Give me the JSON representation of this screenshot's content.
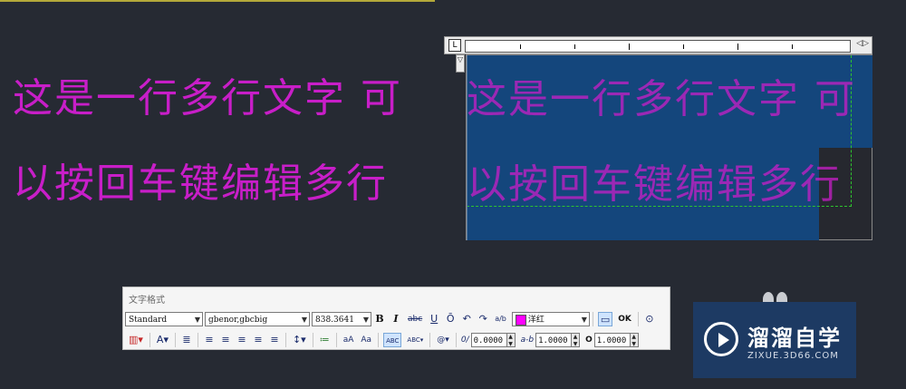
{
  "canvas": {
    "line1": "这是一行多行文字  可",
    "line2": "以按回车键编辑多行"
  },
  "editor": {
    "ruler_tab_label": "L",
    "ruler_end_label": "◁▷",
    "indent_label": "▽",
    "line1": "这是一行多行文字  可",
    "line2": "以按回车键编辑多行"
  },
  "toolbar": {
    "title": "文字格式",
    "style": "Standard",
    "font": "gbenor,gbcbig",
    "height": "838.3641",
    "bold": "B",
    "italic": "I",
    "strike": "abc",
    "underline": "U",
    "overline": "Ō",
    "undo": "↶",
    "redo": "↷",
    "stack": "a/b",
    "color_label": "洋红",
    "color_hex": "#ff00ff",
    "ruler_toggle": "▭",
    "ok": "OK",
    "options": "⊙",
    "columns": "▥▾",
    "mtext_just": "A▾",
    "para": "≣",
    "align_left": "≡",
    "align_center": "≡",
    "align_right": "≡",
    "align_justify": "≡",
    "align_distribute": "≡",
    "line_spacing": "↕▾",
    "numbering": "≔",
    "upper": "aA",
    "lower": "Aa",
    "field": "ABC",
    "spell": "ABC▾",
    "symbol": "@▾",
    "oblique_icon": "0/",
    "oblique": "0.0000",
    "tracking_icon": "a-b",
    "tracking": "1.0000",
    "width_icon": "O",
    "width": "1.0000"
  },
  "logo": {
    "title": "溜溜自学",
    "subtitle": "ZIXUE.3D66.COM"
  },
  "colors": {
    "background": "#262a33",
    "text_magenta": "#c81ec8",
    "selection": "#14467c",
    "logo_bg": "#1d3a63"
  }
}
